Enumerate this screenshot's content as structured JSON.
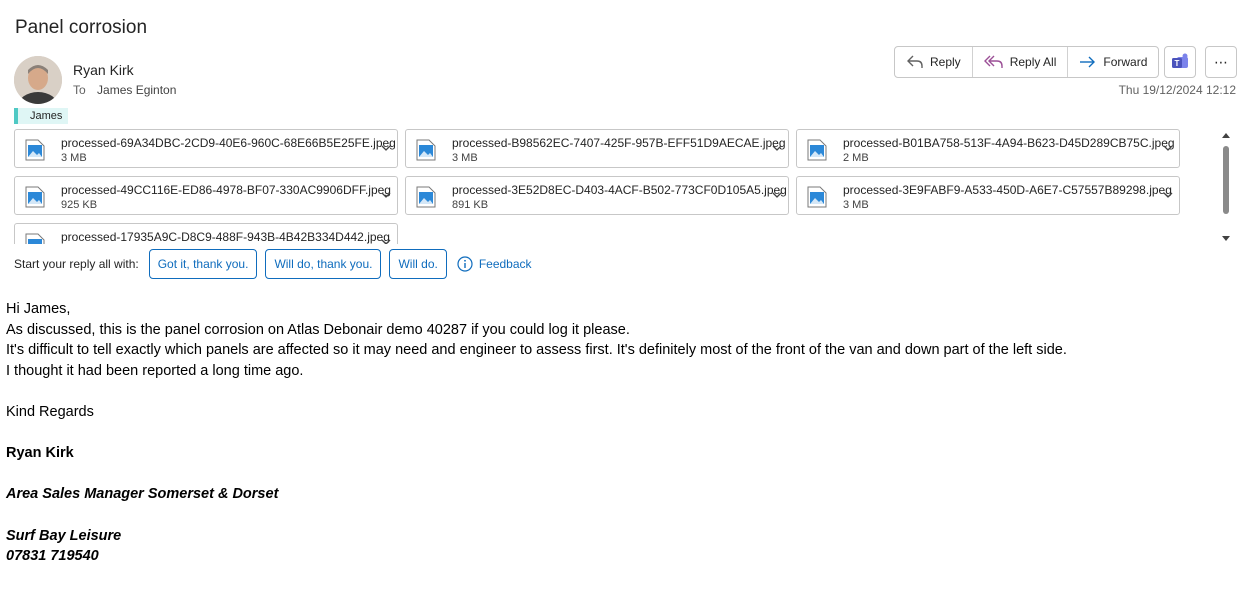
{
  "email": {
    "subject": "Panel corrosion",
    "sender": "Ryan Kirk",
    "to_label": "To",
    "recipient": "James Eginton",
    "category": "James",
    "date": "Thu 19/12/2024 12:12"
  },
  "actions": {
    "reply": "Reply",
    "reply_all": "Reply All",
    "forward": "Forward",
    "more": "⋯"
  },
  "attachments": [
    {
      "name": "processed-69A34DBC-2CD9-40E6-960C-68E66B5E25FE.jpeg",
      "size": "3 MB"
    },
    {
      "name": "processed-B98562EC-7407-425F-957B-EFF51D9AECAE.jpeg",
      "size": "3 MB"
    },
    {
      "name": "processed-B01BA758-513F-4A94-B623-D45D289CB75C.jpeg",
      "size": "2 MB"
    },
    {
      "name": "processed-49CC116E-ED86-4978-BF07-330AC9906DFF.jpeg",
      "size": "925 KB"
    },
    {
      "name": "processed-3E52D8EC-D403-4ACF-B502-773CF0D105A5.jpeg",
      "size": "891 KB"
    },
    {
      "name": "processed-3E9FABF9-A533-450D-A6E7-C57557B89298.jpeg",
      "size": "3 MB"
    },
    {
      "name": "processed-17935A9C-D8C9-488F-943B-4B42B334D442.jpeg",
      "size": ""
    }
  ],
  "suggested_replies": {
    "label": "Start your reply all with:",
    "options": [
      "Got it, thank you.",
      "Will do, thank you.",
      "Will do."
    ],
    "feedback": "Feedback"
  },
  "body": {
    "greeting": "Hi James,",
    "line1": "As discussed, this is the panel corrosion on Atlas Debonair demo 40287 if you could log it please.",
    "line2": "It's difficult to tell exactly which panels are affected so it may need and engineer to assess first. It's definitely most of the front of the van and down part of the left side.",
    "line3": "I thought it had been reported a long time ago.",
    "regards": "Kind Regards",
    "sig_name": "Ryan Kirk",
    "sig_title": "Area Sales Manager Somerset & Dorset",
    "sig_company": "Surf Bay Leisure",
    "sig_phone": "07831 719540"
  },
  "colors": {
    "accent": "#0f6cbd",
    "category": "#4fc9c4",
    "teams": "#5b5fc7"
  }
}
